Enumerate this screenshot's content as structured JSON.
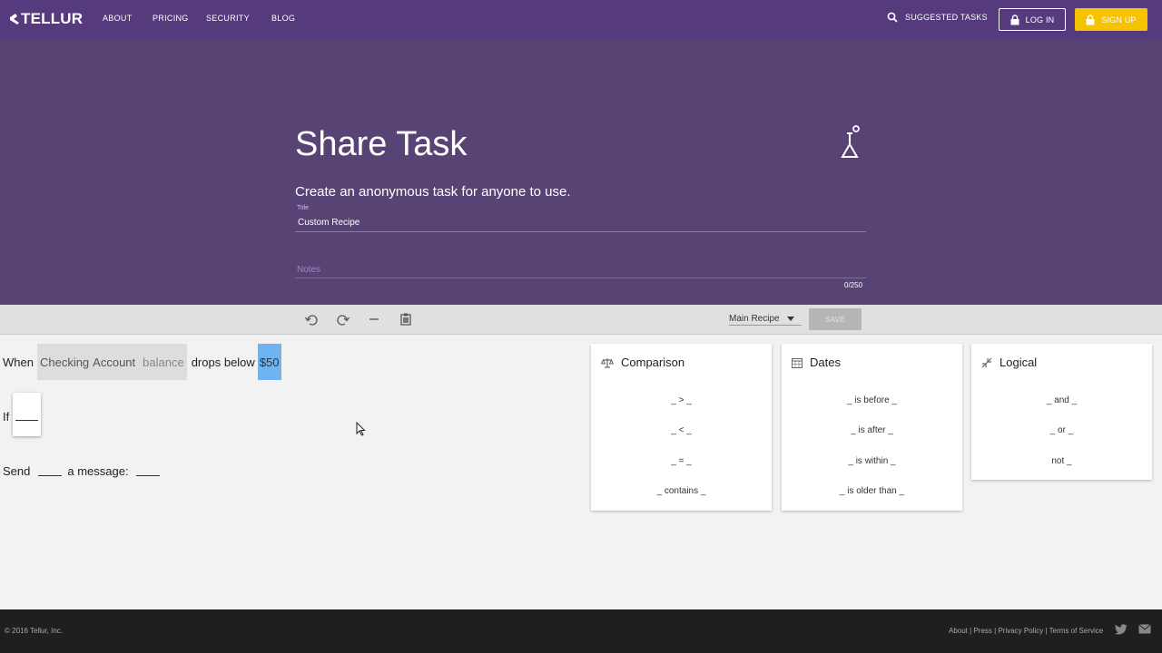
{
  "navbar": {
    "logo": "TELLUR",
    "links": [
      "ABOUT",
      "PRICING",
      "SECURITY",
      "BLOG"
    ],
    "suggested": "SUGGESTED TASKS",
    "login": "LOG IN",
    "signup": "SIGN UP"
  },
  "hero": {
    "title": "Share Task",
    "subtitle": "Create an anonymous task for anyone to use.",
    "title_field_label": "Title",
    "title_field_value": "Custom Recipe",
    "notes_placeholder": "Notes",
    "counter": "0/250"
  },
  "toolbar": {
    "recipe_select": "Main Recipe",
    "save": "SAVE"
  },
  "recipe": {
    "when": "When",
    "account_1": "Checking",
    "account_2": "Account",
    "balance": "balance",
    "drops": "drops below",
    "amount": "$50",
    "if": "If",
    "send": "Send",
    "a_message": "a message:"
  },
  "palettes": [
    {
      "title": "Comparison",
      "items": [
        "_ > _",
        "_ < _",
        "_ = _",
        "_ contains _"
      ]
    },
    {
      "title": "Dates",
      "items": [
        "_ is before _",
        "_ is after _",
        "_ is within _",
        "_ is older than _"
      ]
    },
    {
      "title": "Logical",
      "items": [
        "_ and _",
        "_ or _",
        "not _"
      ]
    }
  ],
  "footer": {
    "copyright": "© 2016 Tellur, Inc.",
    "links": [
      "About",
      "Press",
      "Privacy Policy",
      "Terms of Service"
    ]
  }
}
